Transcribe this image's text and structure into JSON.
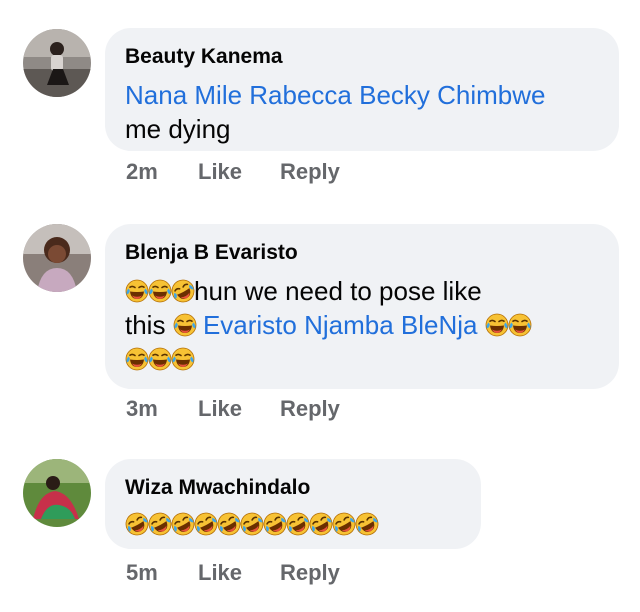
{
  "comments": [
    {
      "author": "Beauty Kanema",
      "mention": "Nana Mile Rabecca Becky Chimbwe",
      "text_line2": "me dying",
      "time": "2m",
      "like": "Like",
      "reply": "Reply"
    },
    {
      "author": "Blenja B Evaristo",
      "text_a": "hun we need to pose like",
      "text_b": "this",
      "mention": "Evaristo Njamba BleNja",
      "time": "3m",
      "like": "Like",
      "reply": "Reply"
    },
    {
      "author": "Wiza Mwachindalo",
      "time": "5m",
      "like": "Like",
      "reply": "Reply"
    }
  ],
  "icons": {
    "emoji": "face-with-tears-of-joy",
    "emoji_tilted": "rolling-on-the-floor-laughing"
  },
  "colors": {
    "bubble": "#f0f2f5",
    "mention": "#216fdb",
    "meta": "#65676b"
  }
}
